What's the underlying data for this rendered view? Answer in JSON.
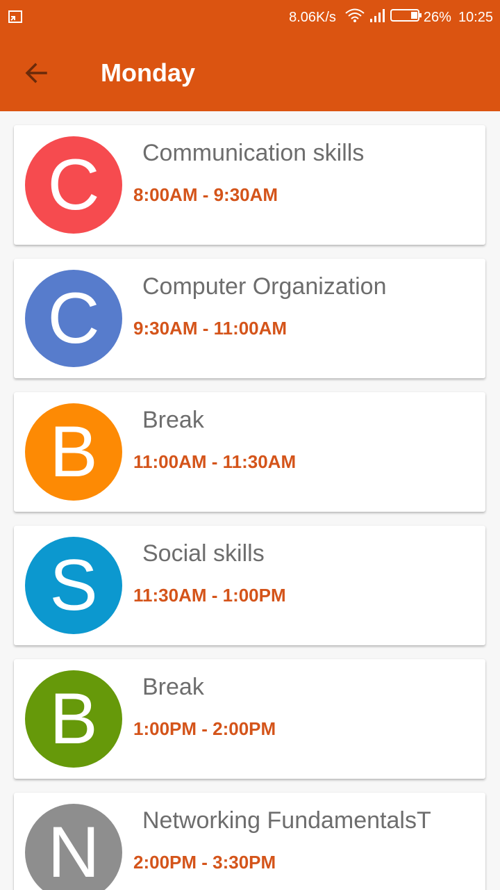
{
  "status_bar": {
    "left_icon": "screen-cast-icon",
    "net_speed": "8.06K/s",
    "wifi_icon": "wifi-icon",
    "signal_icon": "signal-bars-icon",
    "battery_icon": "battery-icon",
    "battery_percent": "26%",
    "time": "10:25"
  },
  "app_bar": {
    "back_icon": "arrow-back-icon",
    "title": "Monday",
    "background": "#db5411"
  },
  "schedule": [
    {
      "letter": "C",
      "subject": "Communication skills",
      "time": "8:00AM - 9:30AM",
      "color": "#f64b4f"
    },
    {
      "letter": "C",
      "subject": "Computer Organization",
      "time": "9:30AM - 11:00AM",
      "color": "#577ccc"
    },
    {
      "letter": "B",
      "subject": "Break",
      "time": "11:00AM - 11:30AM",
      "color": "#fd8a04"
    },
    {
      "letter": "S",
      "subject": "Social skills",
      "time": "11:30AM - 1:00PM",
      "color": "#0c98cf"
    },
    {
      "letter": "B",
      "subject": "Break",
      "time": "1:00PM - 2:00PM",
      "color": "#66990a"
    },
    {
      "letter": "N",
      "subject": "Networking FundamentalsT",
      "time": "2:00PM - 3:30PM",
      "color": "#8e8e8e"
    }
  ]
}
